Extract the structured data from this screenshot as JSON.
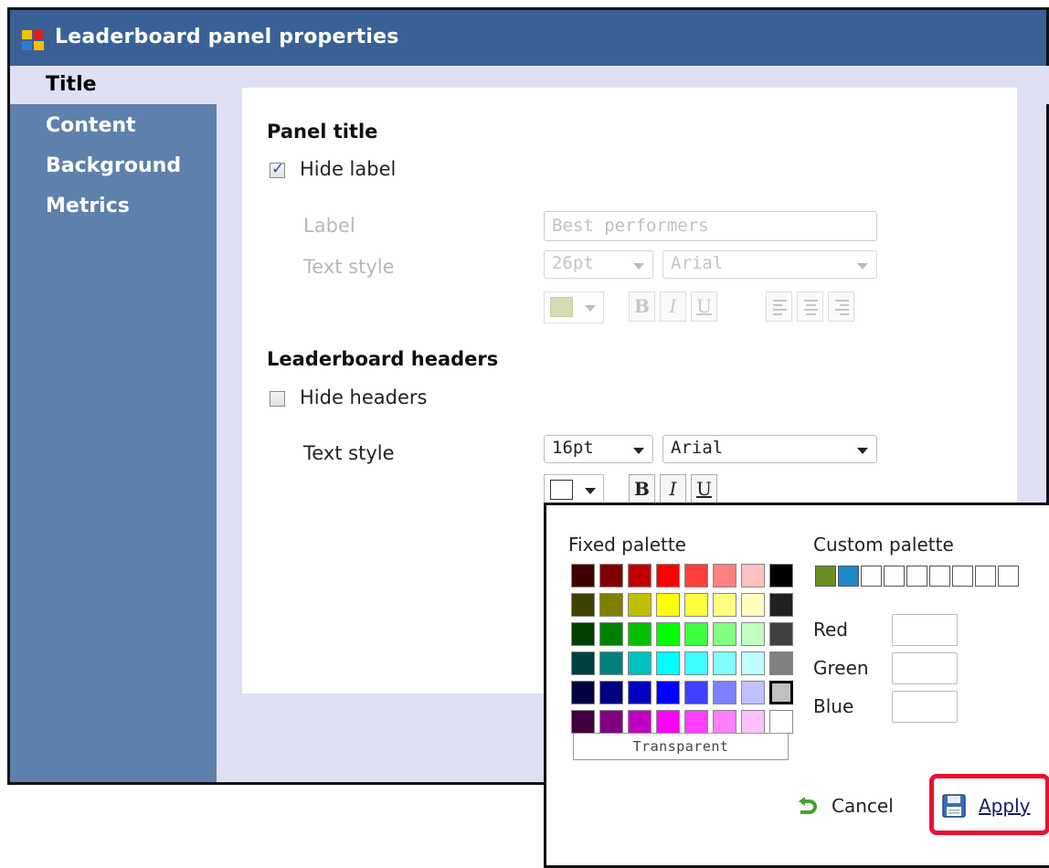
{
  "window": {
    "title": "Leaderboard panel properties",
    "icon": "app-grid-icon"
  },
  "sidebar": {
    "items": [
      {
        "label": "Title",
        "active": true
      },
      {
        "label": "Content",
        "active": false
      },
      {
        "label": "Background",
        "active": false
      },
      {
        "label": "Metrics",
        "active": false
      }
    ]
  },
  "panel_title": {
    "heading": "Panel title",
    "hide_label": {
      "label": "Hide label",
      "checked": true
    },
    "label_field": {
      "label": "Label",
      "value": "Best performers"
    },
    "text_style": {
      "label": "Text style",
      "size": "26pt",
      "font": "Arial",
      "color": "#d4dcb4"
    },
    "format_buttons": [
      "B",
      "I",
      "U"
    ]
  },
  "headers": {
    "heading": "Leaderboard headers",
    "hide_headers": {
      "label": "Hide headers",
      "checked": false
    },
    "text_style": {
      "label": "Text style",
      "size": "16pt",
      "font": "Arial",
      "color": "#ffffff"
    },
    "format_buttons": [
      "B",
      "I",
      "U"
    ]
  },
  "color_popup": {
    "fixed_label": "Fixed palette",
    "custom_label": "Custom palette",
    "transparent_label": "Transparent",
    "red_label": "Red",
    "green_label": "Green",
    "blue_label": "Blue",
    "cancel_label": "Cancel",
    "apply_label": "Apply",
    "fixed_palette": [
      [
        "#400000",
        "#800000",
        "#c00000",
        "#ff0000",
        "#ff4040",
        "#ff8080",
        "#ffc0c0",
        "#000000"
      ],
      [
        "#404000",
        "#808000",
        "#c0c000",
        "#ffff00",
        "#ffff40",
        "#ffff80",
        "#ffffc0",
        "#202020"
      ],
      [
        "#004000",
        "#008000",
        "#00c000",
        "#00ff00",
        "#40ff40",
        "#80ff80",
        "#c0ffc0",
        "#404040"
      ],
      [
        "#004040",
        "#008080",
        "#00c0c0",
        "#00ffff",
        "#40ffff",
        "#80ffff",
        "#c0ffff",
        "#808080"
      ],
      [
        "#000040",
        "#000080",
        "#0000c0",
        "#0000ff",
        "#4040ff",
        "#8080ff",
        "#c0c0ff",
        "#c0c0c0"
      ],
      [
        "#400040",
        "#800080",
        "#c000c0",
        "#ff00ff",
        "#ff40ff",
        "#ff80ff",
        "#ffc0ff",
        "#ffffff"
      ]
    ],
    "custom_palette": [
      "#6b8e23",
      "#1e88c8",
      "#ffffff",
      "#ffffff",
      "#ffffff",
      "#ffffff",
      "#ffffff",
      "#ffffff",
      "#ffffff"
    ]
  }
}
